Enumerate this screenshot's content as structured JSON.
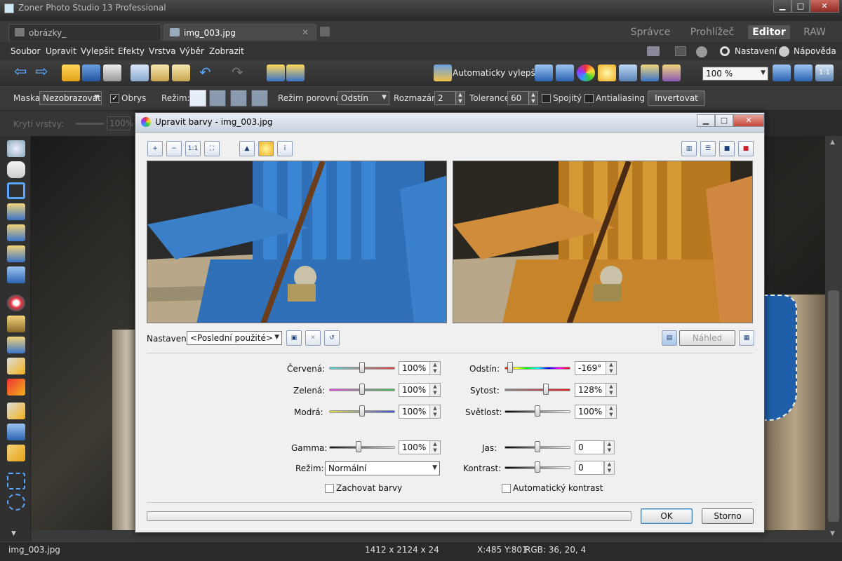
{
  "app": {
    "title": "Zoner Photo Studio 13 Professional"
  },
  "tabs": [
    {
      "label": "obrázky_"
    },
    {
      "label": "img_003.jpg"
    }
  ],
  "modes": [
    {
      "label": "Správce"
    },
    {
      "label": "Prohlížeč"
    },
    {
      "label": "Editor"
    },
    {
      "label": "RAW"
    }
  ],
  "menu": [
    {
      "label": "Soubor"
    },
    {
      "label": "Upravit"
    },
    {
      "label": "Vylepšit"
    },
    {
      "label": "Efekty"
    },
    {
      "label": "Vrstva"
    },
    {
      "label": "Výběr"
    },
    {
      "label": "Zobrazit"
    }
  ],
  "menu_right": {
    "settings": "Nastavení",
    "help": "Nápověda"
  },
  "toolbar": {
    "auto_enhance": "Automaticky vylepšit",
    "zoom": "100 %"
  },
  "options": {
    "mask_label": "Maska:",
    "mask_value": "Nezobrazovat",
    "outline_label": "Obrys",
    "mode_label": "Režim:",
    "compare_label": "Režim porovnání:",
    "compare_value": "Odstín",
    "blur_label": "Rozmazání:",
    "blur_value": "2",
    "tolerance_label": "Tolerance:",
    "tolerance_value": "60",
    "contiguous_label": "Spojitý",
    "antialias_label": "Antialiasing",
    "invert_label": "Invertovat"
  },
  "layer": {
    "opacity_label": "Krytí vrstvy:",
    "opacity_value": "100%"
  },
  "dialog": {
    "title": "Upravit barvy - img_003.jpg",
    "settings_label": "Nastavení:",
    "settings_value": "<Poslední použité>",
    "preview_label": "Náhled",
    "red_label": "Červená:",
    "red_value": "100%",
    "red_level": 0.5,
    "green_label": "Zelená:",
    "green_value": "100%",
    "green_level": 0.5,
    "blue_label": "Modrá:",
    "blue_value": "100%",
    "blue_level": 0.5,
    "gamma_label": "Gamma:",
    "gamma_value": "100%",
    "gamma_level": 0.44,
    "mode_label": "Režim:",
    "mode_value": "Normální",
    "keep_colors_label": "Zachovat barvy",
    "hue_label": "Odstín:",
    "hue_value": "-169°",
    "hue_level": 0.05,
    "saturation_label": "Sytost:",
    "saturation_value": "128%",
    "saturation_level": 0.64,
    "lightness_label": "Světlost:",
    "lightness_value": "100%",
    "lightness_level": 0.5,
    "brightness_label": "Jas:",
    "brightness_value": "0",
    "brightness_level": 0.5,
    "contrast_label": "Kontrast:",
    "contrast_value": "0",
    "contrast_level": 0.5,
    "auto_contrast_label": "Automatický kontrast",
    "ok_label": "OK",
    "cancel_label": "Storno"
  },
  "status": {
    "filename": "img_003.jpg",
    "dimensions": "1412 x 2124 x 24",
    "coords": "X:485 Y:801",
    "rgb": "RGB: 36, 20, 4"
  }
}
